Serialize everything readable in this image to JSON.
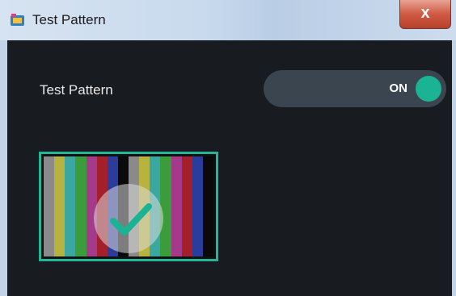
{
  "window": {
    "title": "Test Pattern",
    "close_label": "x"
  },
  "setting": {
    "label": "Test Pattern",
    "toggle_state": "ON"
  },
  "colors": {
    "accent": "#1ab394",
    "panel": "#181c21",
    "toggle_bg": "#3a4550"
  },
  "pattern": {
    "bar_colors": [
      "#8a8a8a",
      "#b8b23e",
      "#3aa7a0",
      "#3a9c3a",
      "#a63a8a",
      "#a3202a",
      "#2a3c9c",
      "#0a0a0a",
      "#8a8a8a",
      "#b8b23e",
      "#3aa7a0",
      "#3a9c3a",
      "#a63a8a",
      "#a3202a",
      "#2a3c9c",
      "#0a0a0a"
    ],
    "selected": true
  },
  "icons": {
    "app": "app-icon",
    "check": "checkmark-icon"
  }
}
